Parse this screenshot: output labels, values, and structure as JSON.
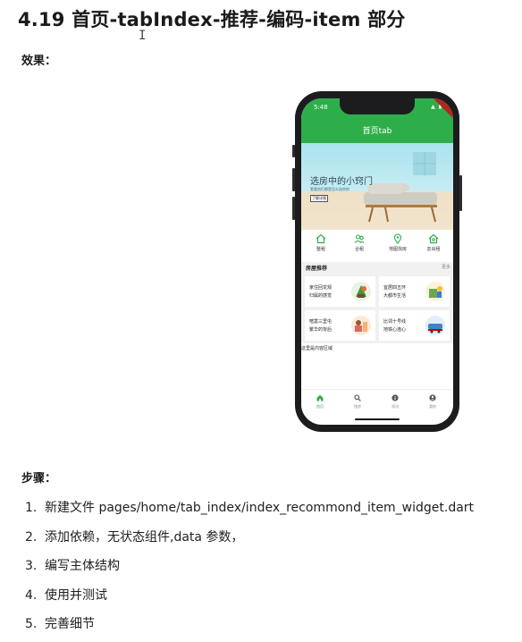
{
  "doc": {
    "title": "4.19 首页-tabIndex-推荐-编码-item 部分",
    "effect_label": "效果：",
    "steps_label": "步骤：",
    "steps": [
      {
        "num": "1.",
        "text": "新建文件 pages/home/tab_index/index_recommond_item_widget.dart"
      },
      {
        "num": "2.",
        "text": "添加依赖，无状态组件,data 参数，"
      },
      {
        "num": "3.",
        "text": "编写主体结构"
      },
      {
        "num": "4.",
        "text": "使用并测试"
      },
      {
        "num": "5.",
        "text": "完善细节"
      }
    ]
  },
  "phone": {
    "status_time": "5:48",
    "status_icons": "▲ ▮",
    "appbar_title": "首页tab",
    "banner": {
      "title": "选房中的小窍门",
      "subtitle": "看看他们都是怎么选房的",
      "button": "了解详情"
    },
    "nav": [
      {
        "label": "整租",
        "icon": "home-icon"
      },
      {
        "label": "合租",
        "icon": "people-icon"
      },
      {
        "label": "地图找房",
        "icon": "map-icon"
      },
      {
        "label": "去出租",
        "icon": "house-key-icon"
      }
    ],
    "recommend": {
      "title": "房屋推荐",
      "more": "更多",
      "items": [
        {
          "line1": "家住回龙观",
          "line2": "归属的感觉"
        },
        {
          "line1": "宜居四五环",
          "line2": "大都市生活"
        },
        {
          "line1": "喧嚣三里屯",
          "line2": "繁华的背后"
        },
        {
          "line1": "比邻十号线",
          "line2": "地铁心连心"
        }
      ]
    },
    "content_text": "这里是内容区域",
    "tabs": [
      {
        "label": "首页",
        "icon": "home-tab-icon",
        "active": true
      },
      {
        "label": "找房",
        "icon": "search-icon",
        "active": false
      },
      {
        "label": "资讯",
        "icon": "info-icon",
        "active": false
      },
      {
        "label": "我的",
        "icon": "account-icon",
        "active": false
      }
    ]
  },
  "colors": {
    "brand_green": "#2eae4a",
    "inactive_gray": "#888888"
  }
}
